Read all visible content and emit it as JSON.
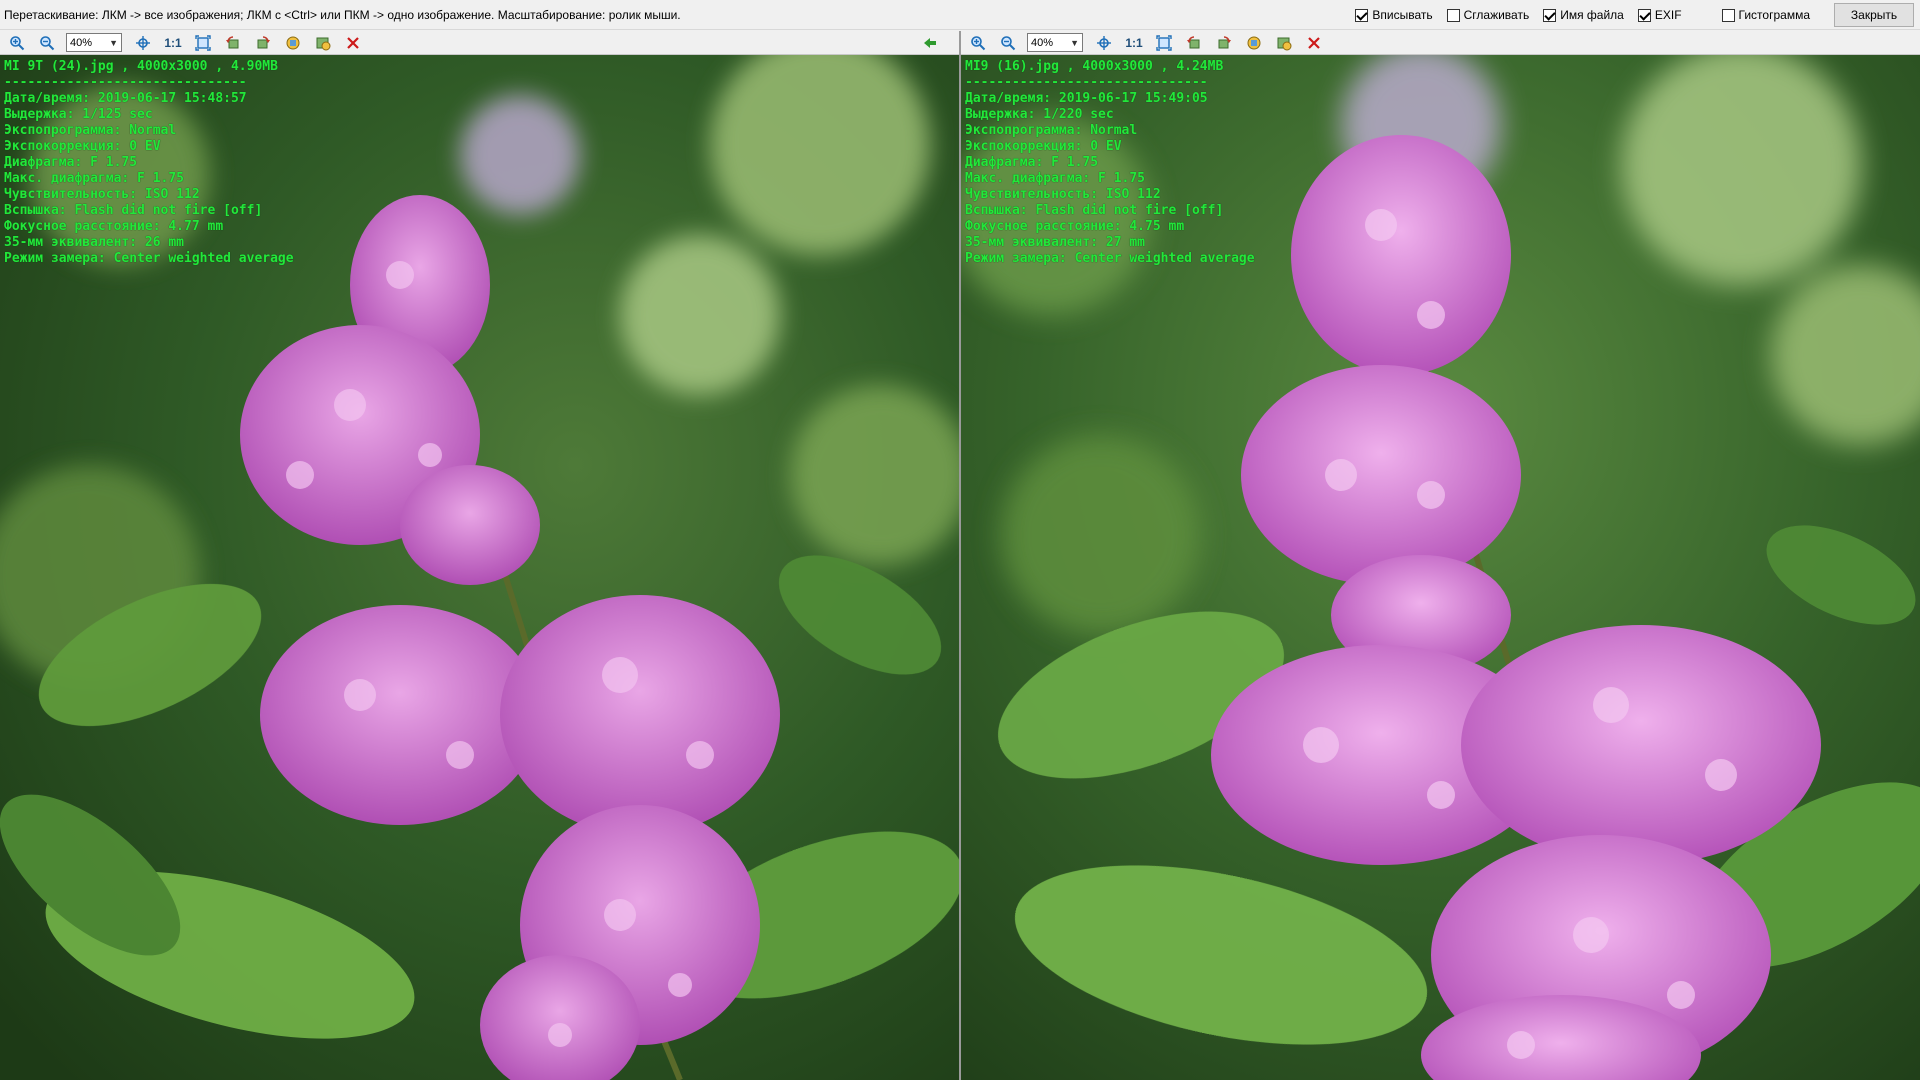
{
  "hint": "Перетаскивание: ЛКМ -> все изображения; ЛКМ с <Ctrl> или ПКМ -> одно изображение. Масштабирование: ролик мыши.",
  "options": [
    {
      "id": "fit",
      "label": "Вписывать",
      "checked": true
    },
    {
      "id": "smooth",
      "label": "Сглаживать",
      "checked": false
    },
    {
      "id": "filename",
      "label": "Имя файла",
      "checked": true
    },
    {
      "id": "exif",
      "label": "EXIF",
      "checked": true
    },
    {
      "id": "histogram",
      "label": "Гистограмма",
      "checked": false
    }
  ],
  "close_label": "Закрыть",
  "colors": {
    "exif_text": "#22e83a",
    "close_icon": "#cc1a1a",
    "accent_icon": "#1f6fb8"
  },
  "panes": [
    {
      "zoom": "40%",
      "one_to_one": "1:1",
      "header": "MI 9T (24).jpg , 4000x3000 , 4.90MB",
      "separator": "-------------------------------",
      "exif": [
        "Дата/время: 2019-06-17 15:48:57",
        "Выдержка: 1/125 sec",
        "Экспопрограмма: Normal",
        "Экспокоррекция: 0 EV",
        "Диафрагма: F 1.75",
        "Макс. диафрагма: F 1.75",
        "Чувствительность: ISO 112",
        "Вспышка: Flash did not fire [off]",
        "Фокусное расстояние: 4.77 mm",
        "35-мм эквивалент: 26 mm",
        "Режим замера: Center weighted average"
      ]
    },
    {
      "zoom": "40%",
      "one_to_one": "1:1",
      "header": "MI9 (16).jpg , 4000x3000 , 4.24MB",
      "separator": "-------------------------------",
      "exif": [
        "Дата/время: 2019-06-17 15:49:05",
        "Выдержка: 1/220 sec",
        "Экспопрограмма: Normal",
        "Экспокоррекция: 0 EV",
        "Диафрагма: F 1.75",
        "Макс. диафрагма: F 1.75",
        "Чувствительность: ISO 112",
        "Вспышка: Flash did not fire [off]",
        "Фокусное расстояние: 4.75 mm",
        "35-мм эквивалент: 27 mm",
        "Режим замера: Center weighted average"
      ]
    }
  ]
}
